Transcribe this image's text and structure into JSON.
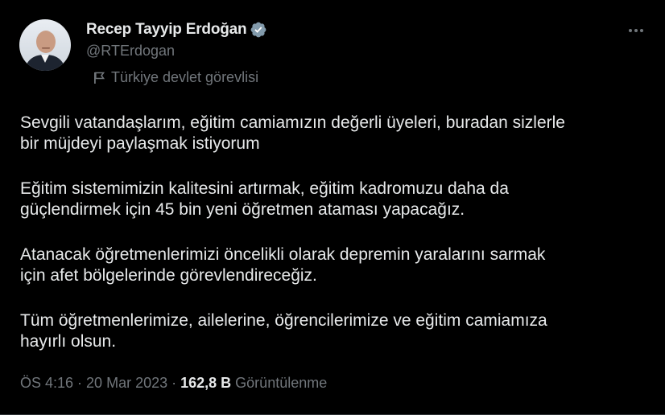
{
  "author": {
    "display_name": "Recep Tayyip Erdoğan",
    "handle": "@RTErdogan",
    "affiliation": "Türkiye devlet görevlisi",
    "verified_color": "#829aab"
  },
  "tweet": {
    "paragraphs": [
      "Sevgili vatandaşlarım, eğitim camiamızın değerli üyeleri, buradan sizlerle\nbir müjdeyi paylaşmak istiyorum",
      "Eğitim sistemimizin kalitesini artırmak, eğitim kadromuzu daha da\ngüçlendirmek için 45 bin yeni öğretmen ataması yapacağız.",
      "Atanacak öğretmenlerimizi öncelikli olarak depremin yaralarını sarmak\niçin afet bölgelerinde görevlendireceğiz.",
      "Tüm öğretmenlerimize, ailelerine, öğrencilerimize ve eğitim camiamıza\nhayırlı olsun."
    ]
  },
  "meta": {
    "time": "ÖS 4:16",
    "separator": "·",
    "date": "20 Mar 2023",
    "views_count": "162,8 B",
    "views_label": "Görüntülenme"
  },
  "icons": {
    "more": "more-horizontal-icon",
    "verified": "verified-badge-icon",
    "affiliation": "flag-icon"
  },
  "colors": {
    "background": "#000000",
    "text_primary": "#e7e9ea",
    "text_secondary": "#71767b"
  }
}
